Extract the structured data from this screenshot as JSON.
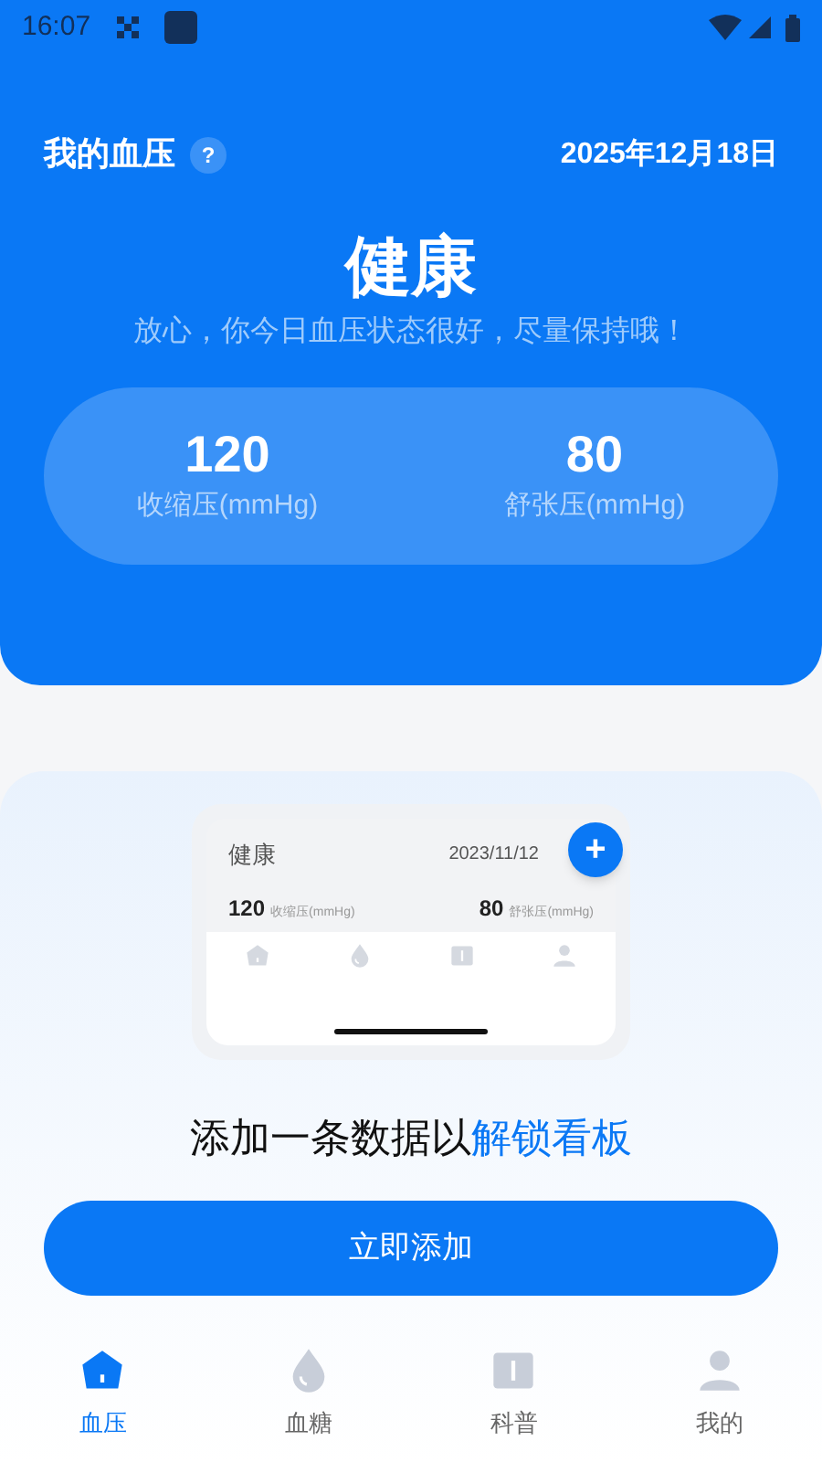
{
  "status_bar": {
    "time": "16:07"
  },
  "header": {
    "title": "我的血压",
    "help": "?",
    "date": "2025年12月18日"
  },
  "status": {
    "label": "健康",
    "message": "放心，你今日血压状态很好，尽量保持哦！"
  },
  "readings": [
    {
      "value": "120",
      "label": "收缩压(mmHg)"
    },
    {
      "value": "80",
      "label": "舒张压(mmHg)"
    }
  ],
  "preview": {
    "status": "健康",
    "date": "2023/11/12",
    "add": "+",
    "systolic": "120",
    "systolic_label": "收缩压(mmHg)",
    "diastolic": "80",
    "diastolic_label": "舒张压(mmHg)"
  },
  "prompt": {
    "text": "添加一条数据以",
    "link": "解锁看板"
  },
  "add_button": "立即添加",
  "nav": [
    {
      "kind": "home",
      "label": "血压",
      "selected": true
    },
    {
      "kind": "drop",
      "label": "血糖",
      "selected": false
    },
    {
      "kind": "book",
      "label": "科普",
      "selected": false
    },
    {
      "kind": "person",
      "label": "我的",
      "selected": false
    }
  ]
}
